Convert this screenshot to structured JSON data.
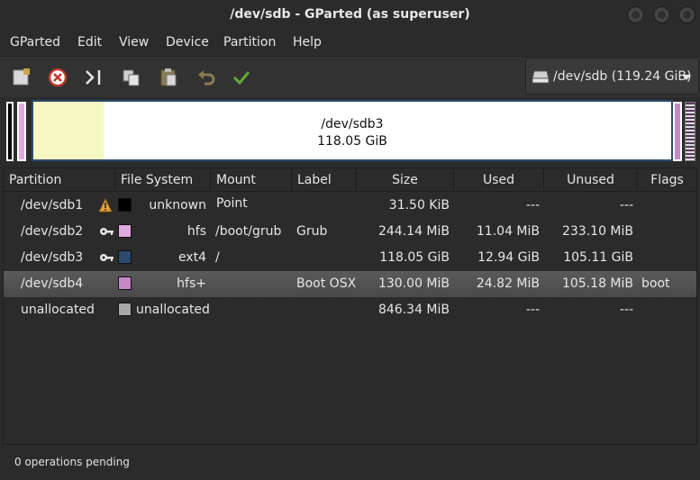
{
  "window": {
    "title": "/dev/sdb - GParted (as superuser)"
  },
  "menu": [
    "GParted",
    "Edit",
    "View",
    "Device",
    "Partition",
    "Help"
  ],
  "toolbar": {
    "buttons": [
      {
        "icon": "new-partition-icon"
      },
      {
        "icon": "delete-icon"
      },
      {
        "icon": "resize-move-icon"
      },
      {
        "icon": "copy-icon"
      },
      {
        "icon": "paste-icon"
      },
      {
        "icon": "undo-icon"
      },
      {
        "icon": "apply-icon"
      }
    ],
    "device": "/dev/sdb (119.24 GiB)"
  },
  "graph": {
    "main_partition": "/dev/sdb3",
    "main_size": "118.05 GiB",
    "used_fraction": 0.11
  },
  "table": {
    "columns": [
      "Partition",
      "File System",
      "Mount Point",
      "Label",
      "Size",
      "Used",
      "Unused",
      "Flags"
    ],
    "rows": [
      {
        "partition": "/dev/sdb1",
        "fs": "unknown",
        "mount": "",
        "label": "",
        "size": "31.50 KiB",
        "used": "---",
        "unused": "---",
        "flags": "",
        "color": "#000000",
        "warning": true,
        "locked": false
      },
      {
        "partition": "/dev/sdb2",
        "fs": "hfs",
        "mount": "/boot/grub",
        "label": "Grub",
        "size": "244.14 MiB",
        "used": "11.04 MiB",
        "unused": "233.10 MiB",
        "flags": "",
        "color": "#e0a9e0",
        "warning": false,
        "locked": true
      },
      {
        "partition": "/dev/sdb3",
        "fs": "ext4",
        "mount": "/",
        "label": "",
        "size": "118.05 GiB",
        "used": "12.94 GiB",
        "unused": "105.11 GiB",
        "flags": "",
        "color": "#2c4a6b",
        "warning": false,
        "locked": true
      },
      {
        "partition": "/dev/sdb4",
        "fs": "hfs+",
        "mount": "",
        "label": "Boot OSX",
        "size": "130.00 MiB",
        "used": "24.82 MiB",
        "unused": "105.18 MiB",
        "flags": "boot",
        "color": "#c48ac4",
        "warning": false,
        "locked": false,
        "selected": true
      },
      {
        "partition": "unallocated",
        "fs": "unallocated",
        "mount": "",
        "label": "",
        "size": "846.34 MiB",
        "used": "---",
        "unused": "---",
        "flags": "",
        "color": "#a8a8a8",
        "warning": false,
        "locked": false
      }
    ]
  },
  "status": "0 operations pending"
}
